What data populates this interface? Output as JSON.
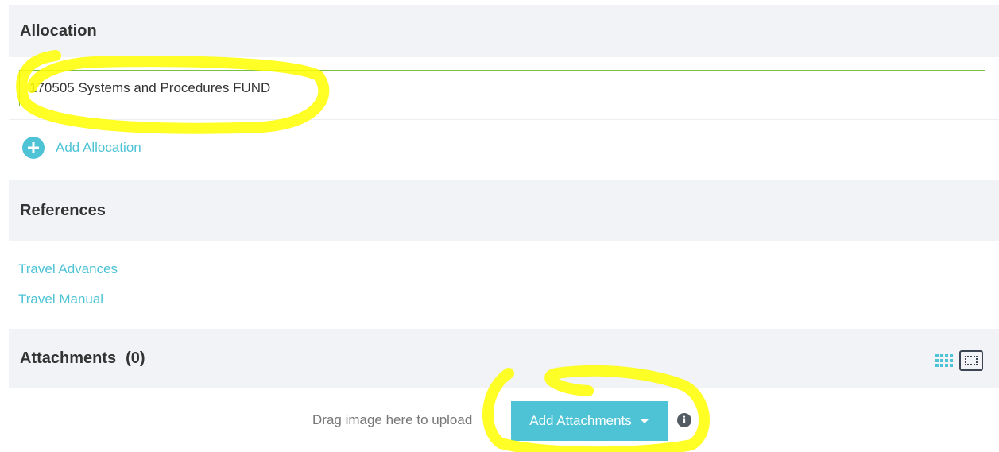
{
  "allocation": {
    "header": "Allocation",
    "field_value": "170505 Systems and Procedures FUND",
    "add_label": "Add Allocation"
  },
  "references": {
    "header": "References",
    "links": [
      "Travel Advances",
      "Travel Manual"
    ]
  },
  "attachments": {
    "header": "Attachments",
    "count": "(0)",
    "drag_text": "Drag image here to upload",
    "add_button_label": "Add Attachments",
    "info_glyph": "i"
  },
  "icons": {
    "add_allocation": "plus-circle-icon",
    "grid_view": "grid-icon",
    "full_view": "fullscreen-icon",
    "dropdown": "caret-down-icon",
    "info": "info-icon"
  },
  "colors": {
    "accent": "#4ec3d6",
    "header_bg": "#f1f3f6",
    "field_border": "#7cbf41",
    "highlight": "#ffff00"
  }
}
